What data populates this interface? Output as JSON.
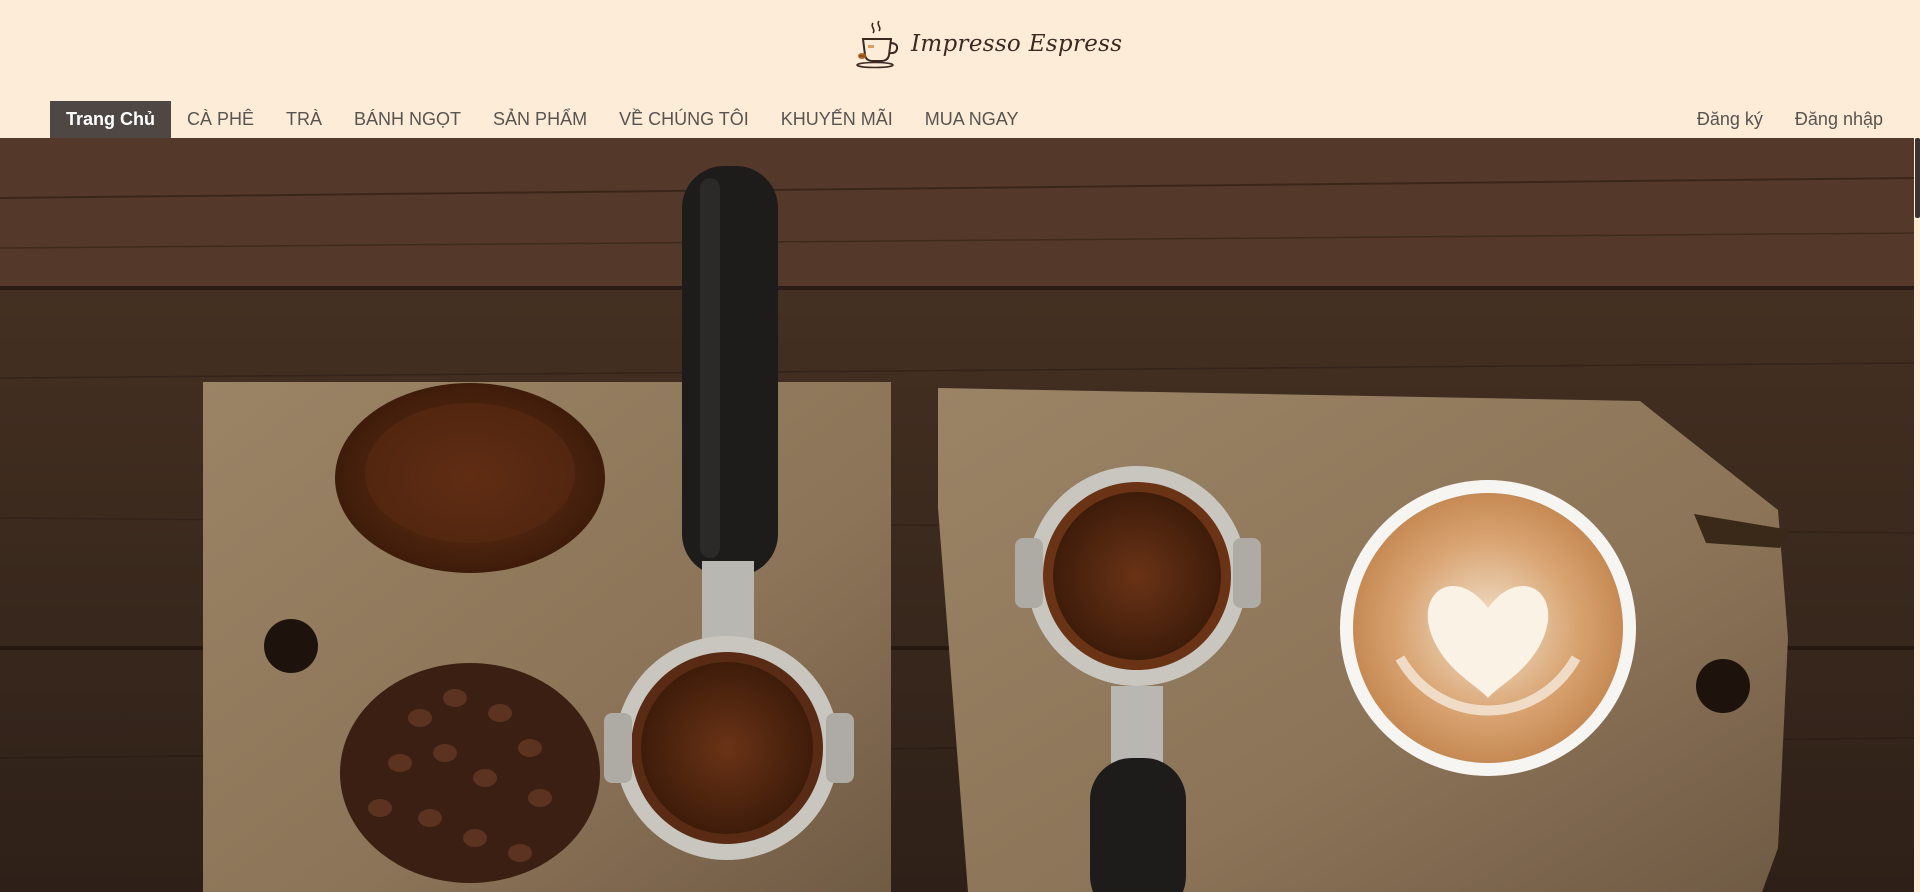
{
  "brand": {
    "name": "Impresso Espress"
  },
  "nav": {
    "items": [
      {
        "label": "Trang Chủ",
        "active": true
      },
      {
        "label": "CÀ PHÊ"
      },
      {
        "label": "TRÀ"
      },
      {
        "label": "BÁNH NGỌT"
      },
      {
        "label": "SẢN PHẨM"
      },
      {
        "label": "VỀ CHÚNG TÔI"
      },
      {
        "label": "KHUYẾN MÃI"
      },
      {
        "label": "MUA NGAY"
      }
    ],
    "account": {
      "register": "Đăng ký",
      "login": "Đăng nhập"
    }
  },
  "colors": {
    "header_bg": "#fcecd8",
    "nav_active_bg": "#4e4743",
    "nav_text": "#5a5450"
  },
  "icons": {
    "logo": "coffee-cup-icon"
  }
}
